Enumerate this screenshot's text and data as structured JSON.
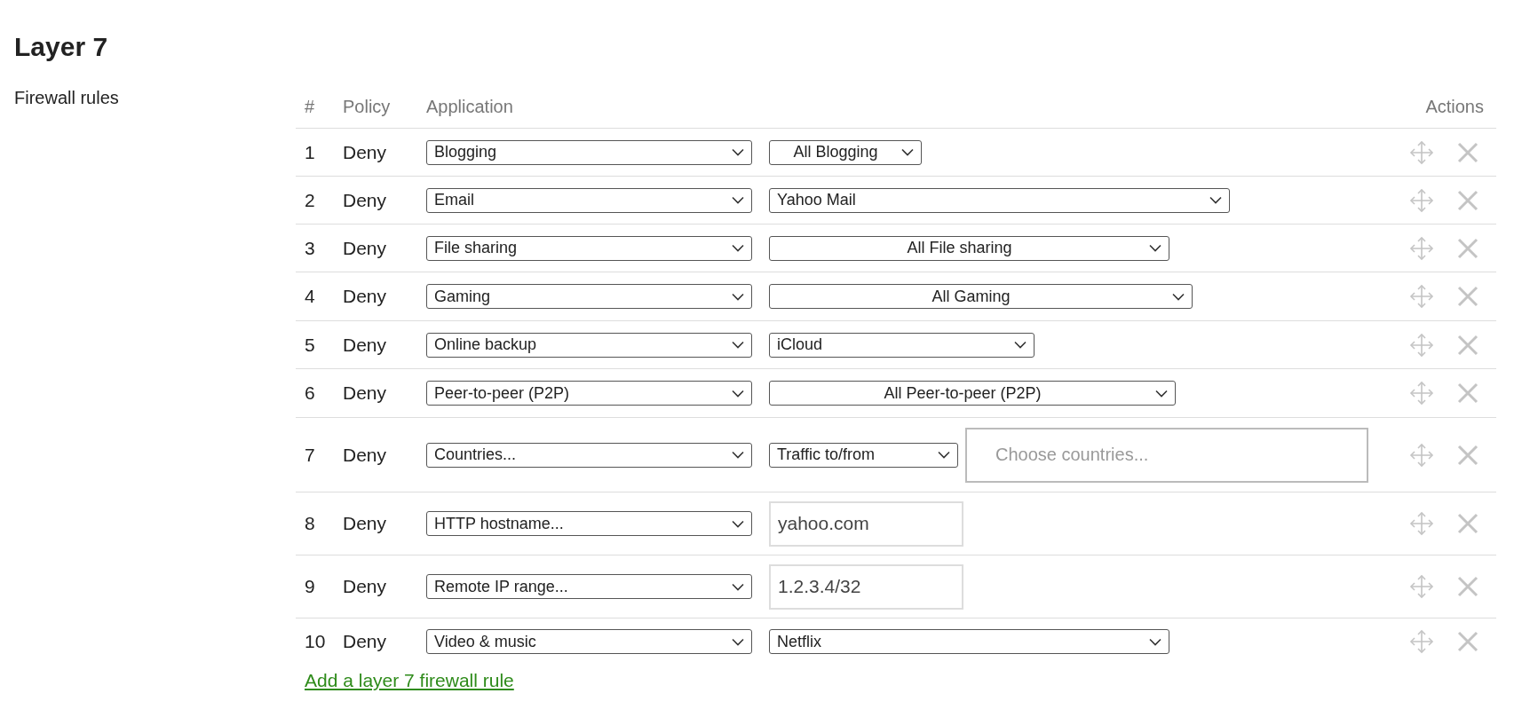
{
  "heading": "Layer 7",
  "section_label": "Firewall rules",
  "table": {
    "columns": [
      "#",
      "Policy",
      "Application",
      "Actions"
    ],
    "rows": [
      {
        "number": "1",
        "policy": "Deny",
        "application": "Blogging",
        "target": {
          "kind": "select",
          "value": "All Blogging",
          "centered": true
        }
      },
      {
        "number": "2",
        "policy": "Deny",
        "application": "Email",
        "target": {
          "kind": "select",
          "value": "Yahoo Mail",
          "centered": false
        }
      },
      {
        "number": "3",
        "policy": "Deny",
        "application": "File sharing",
        "target": {
          "kind": "select",
          "value": "All File sharing",
          "centered": true
        }
      },
      {
        "number": "4",
        "policy": "Deny",
        "application": "Gaming",
        "target": {
          "kind": "select",
          "value": "All Gaming",
          "centered": true
        }
      },
      {
        "number": "5",
        "policy": "Deny",
        "application": "Online backup",
        "target": {
          "kind": "select",
          "value": "iCloud",
          "centered": false
        }
      },
      {
        "number": "6",
        "policy": "Deny",
        "application": "Peer-to-peer (P2P)",
        "target": {
          "kind": "select",
          "value": "All Peer-to-peer (P2P)",
          "centered": true
        }
      },
      {
        "number": "7",
        "policy": "Deny",
        "application": "Countries...",
        "target": {
          "kind": "countries",
          "value": "Traffic to/from",
          "placeholder": "Choose countries..."
        }
      },
      {
        "number": "8",
        "policy": "Deny",
        "application": "HTTP hostname...",
        "target": {
          "kind": "text",
          "value": "yahoo.com"
        }
      },
      {
        "number": "9",
        "policy": "Deny",
        "application": "Remote IP range...",
        "target": {
          "kind": "text",
          "value": "1.2.3.4/32"
        }
      },
      {
        "number": "10",
        "policy": "Deny",
        "application": "Video & music",
        "target": {
          "kind": "select",
          "value": "Netflix",
          "centered": false
        }
      }
    ]
  },
  "add_link": "Add a layer 7 firewall rule"
}
